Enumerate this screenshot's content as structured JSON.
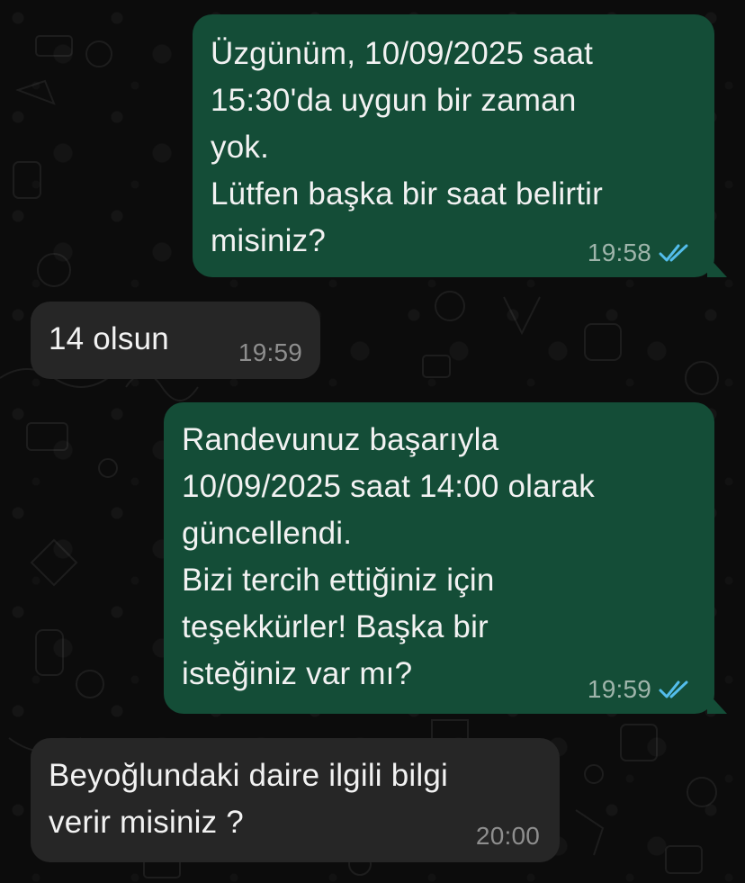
{
  "colors": {
    "outgoing_bubble": "#144d37",
    "incoming_bubble": "#262626",
    "read_ticks": "#53bdeb",
    "background": "#0c0c0c"
  },
  "messages": [
    {
      "direction": "outgoing",
      "text": "Üzgünüm, 10/09/2025 saat\n15:30'da uygun bir zaman\nyok.\nLütfen başka bir saat belirtir\nmisiniz?",
      "time": "19:58",
      "status_icon": "double-check-read-icon"
    },
    {
      "direction": "incoming",
      "text": "14 olsun",
      "time": "19:59"
    },
    {
      "direction": "outgoing",
      "text": "Randevunuz başarıyla\n10/09/2025 saat 14:00 olarak\ngüncellendi.\nBizi tercih ettiğiniz için\nteşekkürler! Başka bir\nisteğiniz var mı?",
      "time": "19:59",
      "status_icon": "double-check-read-icon"
    },
    {
      "direction": "incoming",
      "text": "Beyoğlundaki daire ilgili bilgi\nverir misiniz ?",
      "time": "20:00"
    }
  ]
}
